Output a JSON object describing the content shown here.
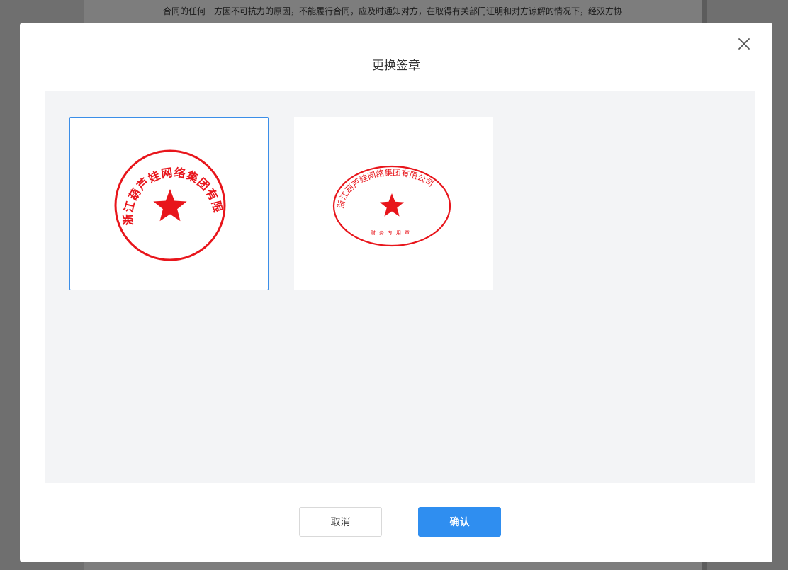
{
  "background_document": {
    "text": "合同的任何一方因不可抗力的原因，不能履行合同，应及时通知对方，在取得有关部门证明和对方谅解的情况下，经双方协"
  },
  "modal": {
    "title": "更换签章",
    "seals": [
      {
        "shape": "circle",
        "company_name": "浙江葫芦娃网络集团有限公司",
        "selected": true,
        "color": "#e8151b"
      },
      {
        "shape": "ellipse",
        "company_name": "浙江葫芦娃网络集团有限公司",
        "subtext": "财务专用章",
        "selected": false,
        "color": "#e8151b"
      }
    ],
    "cancel_label": "取消",
    "confirm_label": "确认"
  },
  "colors": {
    "accent": "#2f8ef0",
    "seal_red": "#e8151b"
  },
  "icons": {
    "close": "close-icon",
    "seal_star": "star-icon"
  }
}
